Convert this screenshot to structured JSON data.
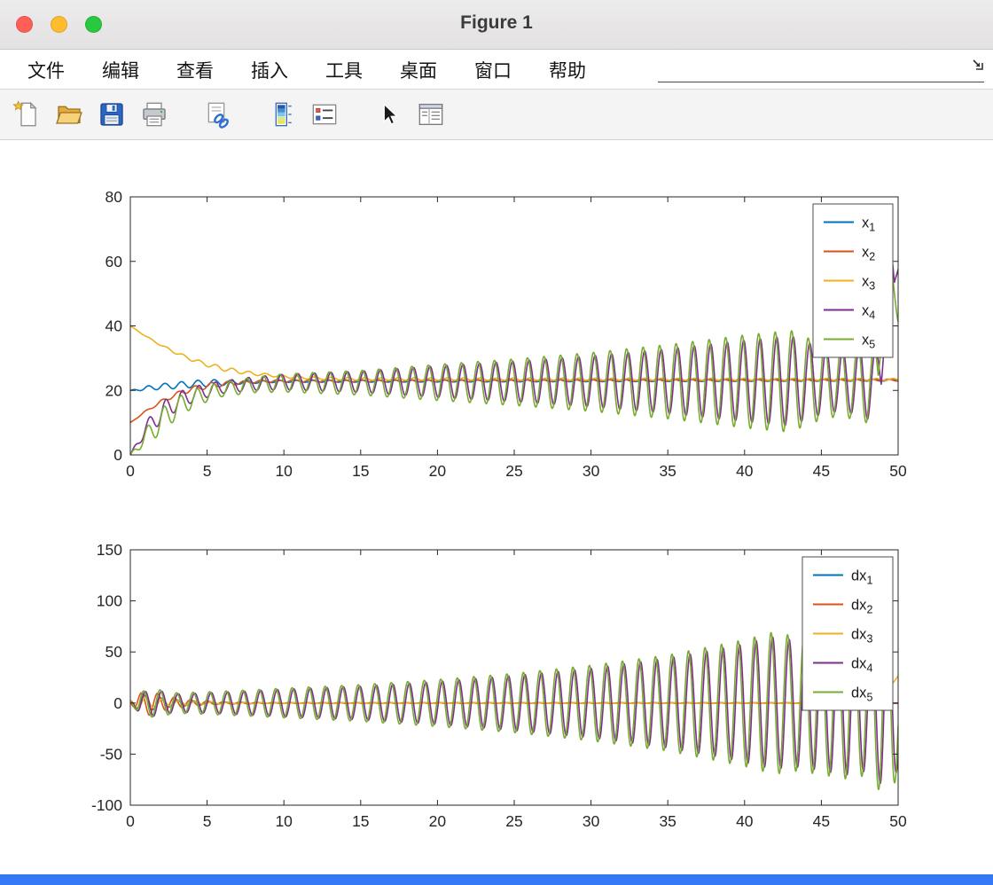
{
  "window": {
    "title": "Figure 1",
    "traffic_lights": {
      "close": "#ff5f57",
      "minimize": "#febc2e",
      "zoom": "#28c840"
    },
    "accent_bar_color": "#3478f6"
  },
  "menu": {
    "items": [
      {
        "key": "file",
        "label": "文件"
      },
      {
        "key": "edit",
        "label": "编辑"
      },
      {
        "key": "view",
        "label": "查看"
      },
      {
        "key": "insert",
        "label": "插入"
      },
      {
        "key": "tools",
        "label": "工具"
      },
      {
        "key": "desktop",
        "label": "桌面"
      },
      {
        "key": "window",
        "label": "窗口"
      },
      {
        "key": "help",
        "label": "帮助"
      }
    ]
  },
  "toolbar": {
    "buttons": [
      {
        "key": "new-figure",
        "group": 0
      },
      {
        "key": "open-file",
        "group": 0
      },
      {
        "key": "save-figure",
        "group": 0
      },
      {
        "key": "print-figure",
        "group": 0
      },
      {
        "key": "link-plot",
        "group": 1
      },
      {
        "key": "insert-colorbar",
        "group": 2
      },
      {
        "key": "insert-legend",
        "group": 2
      },
      {
        "key": "edit-plot",
        "group": 3
      },
      {
        "key": "property-inspector",
        "group": 3
      }
    ]
  },
  "chart_data": [
    {
      "type": "line",
      "name": "states",
      "xlim": [
        0,
        50
      ],
      "ylim": [
        0,
        80
      ],
      "xticks": [
        0,
        5,
        10,
        15,
        20,
        25,
        30,
        35,
        40,
        45,
        50
      ],
      "yticks": [
        0,
        20,
        40,
        60,
        80
      ],
      "grid": false,
      "axis_color": "#262626",
      "legend": {
        "location": "northeast"
      },
      "series": [
        {
          "name": "x1",
          "label_base": "x",
          "label_sub": "1",
          "color": "#0072BD",
          "freq": 0.93,
          "phase": 1.0,
          "base": [
            [
              0,
              20
            ],
            [
              2,
              21.2
            ],
            [
              5,
              22.3
            ],
            [
              10,
              22.8
            ],
            [
              50,
              23.2
            ]
          ],
          "amp": [
            [
              0,
              0
            ],
            [
              1,
              0.7
            ],
            [
              3,
              1.0
            ],
            [
              5,
              1.1
            ],
            [
              7,
              0.6
            ],
            [
              9,
              0.3
            ],
            [
              50,
              0.3
            ]
          ]
        },
        {
          "name": "x2",
          "label_base": "x",
          "label_sub": "2",
          "color": "#D95319",
          "freq": 0.93,
          "phase": 2.1,
          "base": [
            [
              0,
              10
            ],
            [
              1,
              13.5
            ],
            [
              2,
              16.5
            ],
            [
              3,
              18.8
            ],
            [
              4,
              20.4
            ],
            [
              5,
              21.4
            ],
            [
              6,
              22
            ],
            [
              8,
              22.7
            ],
            [
              10,
              23
            ],
            [
              50,
              23.2
            ]
          ],
          "amp": [
            [
              0,
              0
            ],
            [
              2,
              0.5
            ],
            [
              5,
              0.9
            ],
            [
              8,
              0.4
            ],
            [
              50,
              0.3
            ]
          ]
        },
        {
          "name": "x3",
          "label_base": "x",
          "label_sub": "3",
          "color": "#EDB120",
          "freq": 0.93,
          "phase": 0.4,
          "base": [
            [
              0,
              40
            ],
            [
              1,
              36.8
            ],
            [
              2,
              34
            ],
            [
              3,
              31.6
            ],
            [
              4,
              29.6
            ],
            [
              5,
              28
            ],
            [
              6,
              26.8
            ],
            [
              7,
              25.9
            ],
            [
              8,
              25.2
            ],
            [
              10,
              24.3
            ],
            [
              12,
              23.8
            ],
            [
              15,
              23.5
            ],
            [
              50,
              23.4
            ]
          ],
          "amp": [
            [
              0,
              0
            ],
            [
              3,
              0.4
            ],
            [
              6,
              0.7
            ],
            [
              9,
              0.4
            ],
            [
              50,
              0.3
            ]
          ]
        },
        {
          "name": "x4",
          "label_base": "x",
          "label_sub": "4",
          "color": "#7E2F8E",
          "freq": 0.93,
          "phase": 0.63,
          "base": [
            [
              0,
              0
            ],
            [
              1,
              8
            ],
            [
              2,
              13
            ],
            [
              3,
              16.5
            ],
            [
              4,
              18.6
            ],
            [
              5,
              20
            ],
            [
              6,
              21
            ],
            [
              8,
              22.1
            ],
            [
              10,
              22.6
            ],
            [
              48,
              23
            ],
            [
              48.9,
              25
            ],
            [
              49.4,
              65
            ],
            [
              49.75,
              50
            ],
            [
              50,
              60
            ]
          ],
          "amp": [
            [
              0,
              0
            ],
            [
              1,
              2.2
            ],
            [
              2,
              3.2
            ],
            [
              4,
              2.4
            ],
            [
              6,
              1.9
            ],
            [
              8,
              2.1
            ],
            [
              10,
              2.4
            ],
            [
              15,
              3.3
            ],
            [
              20,
              4.9
            ],
            [
              25,
              6.3
            ],
            [
              30,
              7.9
            ],
            [
              35,
              10
            ],
            [
              38,
              11.6
            ],
            [
              40,
              12.6
            ],
            [
              42,
              13.5
            ],
            [
              43,
              14
            ],
            [
              44,
              12
            ],
            [
              45,
              10.5
            ],
            [
              46,
              9.6
            ],
            [
              47,
              10.2
            ],
            [
              48,
              12
            ],
            [
              48.5,
              9
            ],
            [
              49,
              6
            ],
            [
              50,
              4
            ]
          ]
        },
        {
          "name": "x5",
          "label_base": "x",
          "label_sub": "5",
          "color": "#77AC30",
          "freq": 0.93,
          "phase": 1.23,
          "base": [
            [
              0,
              0
            ],
            [
              1,
              5.5
            ],
            [
              2,
              10.5
            ],
            [
              3,
              14.5
            ],
            [
              4,
              17.2
            ],
            [
              5,
              19
            ],
            [
              6,
              20.3
            ],
            [
              8,
              21.7
            ],
            [
              10,
              22.3
            ],
            [
              48,
              22.9
            ],
            [
              48.7,
              24
            ],
            [
              49.25,
              70
            ],
            [
              49.6,
              52
            ],
            [
              50,
              45
            ]
          ],
          "amp": [
            [
              0,
              0
            ],
            [
              1,
              2.7
            ],
            [
              2,
              3.8
            ],
            [
              4,
              2.8
            ],
            [
              6,
              2.2
            ],
            [
              8,
              2.4
            ],
            [
              10,
              2.8
            ],
            [
              15,
              3.8
            ],
            [
              20,
              5.6
            ],
            [
              25,
              7.2
            ],
            [
              30,
              9.1
            ],
            [
              35,
              11.5
            ],
            [
              38,
              13.2
            ],
            [
              40,
              14.4
            ],
            [
              42,
              15.3
            ],
            [
              43,
              15.8
            ],
            [
              44,
              13.6
            ],
            [
              45,
              12
            ],
            [
              46,
              11
            ],
            [
              47,
              11.7
            ],
            [
              48,
              13
            ],
            [
              48.5,
              10
            ],
            [
              49,
              6
            ],
            [
              50,
              4
            ]
          ]
        }
      ]
    },
    {
      "type": "line",
      "name": "derivatives",
      "xlim": [
        0,
        50
      ],
      "ylim": [
        -100,
        150
      ],
      "xticks": [
        0,
        5,
        10,
        15,
        20,
        25,
        30,
        35,
        40,
        45,
        50
      ],
      "yticks": [
        -100,
        -50,
        0,
        50,
        100,
        150
      ],
      "grid": false,
      "axis_color": "#262626",
      "legend": {
        "location": "northeast"
      },
      "series": [
        {
          "name": "dx1",
          "label_base": "dx",
          "label_sub": "1",
          "color": "#0072BD",
          "freq": 0.93,
          "phase": 2.6,
          "base": [
            [
              0,
              0
            ],
            [
              50,
              0
            ]
          ],
          "amp": [
            [
              0,
              0
            ],
            [
              0.4,
              6
            ],
            [
              1,
              8
            ],
            [
              2,
              5
            ],
            [
              3,
              3
            ],
            [
              5,
              1.2
            ],
            [
              8,
              0.4
            ],
            [
              50,
              0.3
            ]
          ]
        },
        {
          "name": "dx2",
          "label_base": "dx",
          "label_sub": "2",
          "color": "#D95319",
          "freq": 0.93,
          "phase": 3.7,
          "base": [
            [
              0,
              0
            ],
            [
              50,
              0
            ]
          ],
          "amp": [
            [
              0,
              0
            ],
            [
              0.5,
              9
            ],
            [
              1.2,
              12
            ],
            [
              2.5,
              6.5
            ],
            [
              4,
              3
            ],
            [
              6,
              1.2
            ],
            [
              9,
              0.5
            ],
            [
              50,
              0.3
            ]
          ]
        },
        {
          "name": "dx3",
          "label_base": "dx",
          "label_sub": "3",
          "color": "#EDB120",
          "freq": 0.93,
          "phase": 2.0,
          "base": [
            [
              0,
              0
            ],
            [
              47,
              0
            ],
            [
              48.5,
              4
            ],
            [
              49.5,
              16
            ],
            [
              50,
              27
            ]
          ],
          "amp": [
            [
              0,
              3
            ],
            [
              1,
              6
            ],
            [
              2.5,
              3
            ],
            [
              4,
              1.5
            ],
            [
              6,
              0.8
            ],
            [
              9,
              0.5
            ],
            [
              50,
              0.4
            ]
          ]
        },
        {
          "name": "dx4",
          "label_base": "dx",
          "label_sub": "4",
          "color": "#7E2F8E",
          "freq": 0.93,
          "phase": 2.2,
          "base": [
            [
              0,
              0
            ],
            [
              50,
              0
            ]
          ],
          "amp": [
            [
              0,
              0
            ],
            [
              0.6,
              10
            ],
            [
              1.5,
              13
            ],
            [
              3,
              9
            ],
            [
              5,
              10
            ],
            [
              8,
              12
            ],
            [
              10,
              13.5
            ],
            [
              15,
              16.5
            ],
            [
              20,
              21
            ],
            [
              25,
              27
            ],
            [
              30,
              34
            ],
            [
              35,
              44
            ],
            [
              38,
              52
            ],
            [
              40,
              58
            ],
            [
              41,
              62
            ],
            [
              42,
              65
            ],
            [
              43,
              62
            ],
            [
              44,
              64
            ],
            [
              45,
              66
            ],
            [
              46,
              69
            ],
            [
              47,
              71
            ],
            [
              47.8,
              67
            ],
            [
              48.6,
              72
            ],
            [
              49.35,
              95
            ],
            [
              49.7,
              80
            ],
            [
              50,
              60
            ]
          ]
        },
        {
          "name": "dx5",
          "label_base": "dx",
          "label_sub": "5",
          "color": "#77AC30",
          "freq": 0.93,
          "phase": 2.8,
          "base": [
            [
              0,
              0
            ],
            [
              50,
              0
            ]
          ],
          "amp": [
            [
              0,
              0
            ],
            [
              0.6,
              11
            ],
            [
              1.5,
              14
            ],
            [
              3,
              10
            ],
            [
              5,
              11
            ],
            [
              8,
              13
            ],
            [
              10,
              14.5
            ],
            [
              15,
              18
            ],
            [
              20,
              23
            ],
            [
              25,
              29
            ],
            [
              30,
              37
            ],
            [
              35,
              47
            ],
            [
              38,
              56
            ],
            [
              40,
              62
            ],
            [
              41,
              66
            ],
            [
              42,
              70
            ],
            [
              43,
              66
            ],
            [
              44,
              68
            ],
            [
              45,
              70
            ],
            [
              46,
              73
            ],
            [
              47,
              75
            ],
            [
              47.8,
              71
            ],
            [
              48.6,
              80
            ],
            [
              49.25,
              105
            ],
            [
              49.6,
              88
            ],
            [
              50,
              66
            ]
          ]
        }
      ]
    }
  ]
}
